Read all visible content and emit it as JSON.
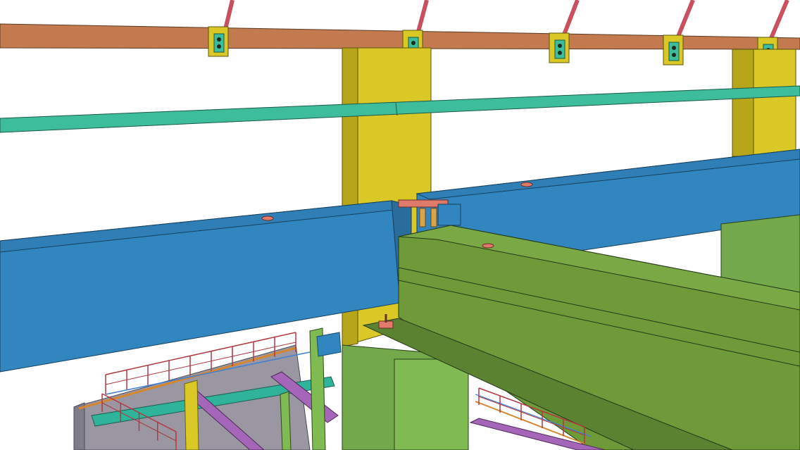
{
  "viewport": {
    "background": "#ffffff",
    "outline_color": "#1f2a1f"
  },
  "model_colors": {
    "roof_purlin": "#c27a4e",
    "bracing_rod": "#c9505e",
    "column": "#d9c825",
    "column_side": "#b7a51a",
    "eave_strut": "#3dbd9b",
    "main_beam": "#3186c0",
    "main_beam_top": "#2f7fb6",
    "main_beam_side": "#2a6d9d",
    "crane_girder": "#6e9a3a",
    "crane_girder_top": "#7aa844",
    "crane_girder_side": "#5a8230",
    "support_column": "#73a94a",
    "connection_plate": "#e07a6a",
    "handrail": "#b2383f",
    "lower_frame": "#9a97a3",
    "lower_frame_side": "#7f7c89",
    "secondary_beam": "#a565b8",
    "teal_beam": "#2fb39b",
    "light_green_post": "#7fba52",
    "cable_blue": "#3d7fd6",
    "cable_orange": "#d5862e"
  },
  "purlin_clips": [
    {
      "id": "clip-1"
    },
    {
      "id": "clip-2"
    },
    {
      "id": "clip-3"
    },
    {
      "id": "clip-4"
    },
    {
      "id": "clip-5"
    }
  ]
}
